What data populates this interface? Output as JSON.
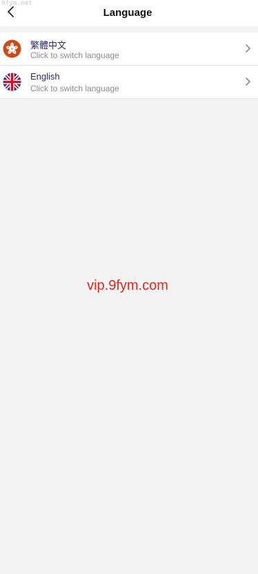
{
  "watermark_corner": "9fym.net",
  "header": {
    "title": "Language"
  },
  "languages": [
    {
      "name": "繁體中文",
      "subtitle": "Click to switch language",
      "icon": "hong-kong-flag-icon"
    },
    {
      "name": "English",
      "subtitle": "Click to switch language",
      "icon": "uk-flag-icon"
    }
  ],
  "center_watermark": "vip.9fym.com",
  "colors": {
    "background": "#f3f3f3",
    "surface": "#ffffff",
    "language_name": "#2a2a6c",
    "subtitle": "#8b8b8b",
    "watermark": "#e8261d"
  }
}
